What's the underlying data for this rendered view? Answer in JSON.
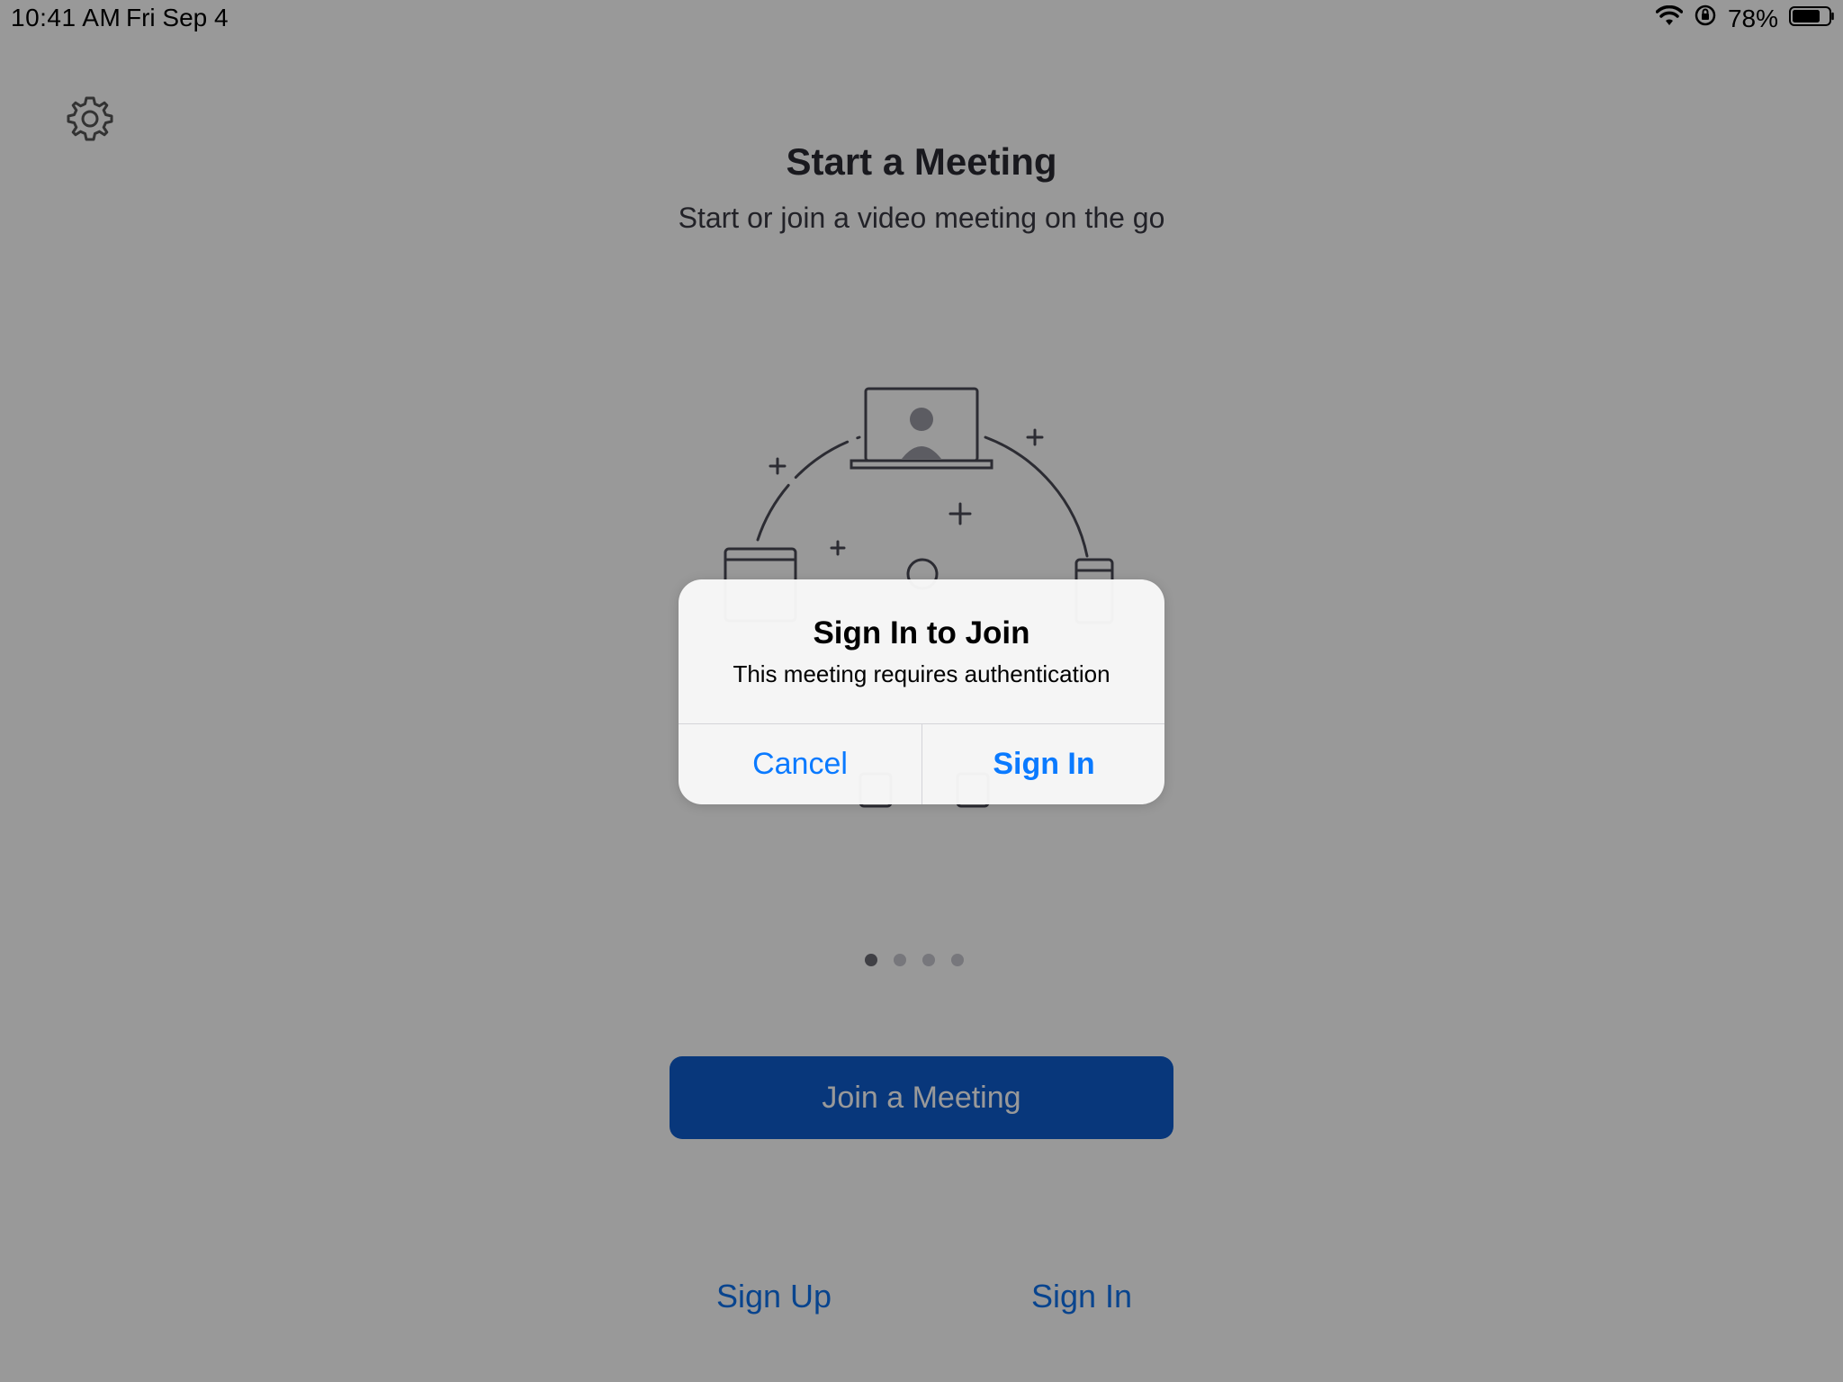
{
  "status_bar": {
    "time": "10:41 AM",
    "date": "Fri Sep 4",
    "battery_percent": "78%",
    "wifi_icon": "wifi-icon",
    "orientation_lock_icon": "orientation-lock-icon",
    "battery_icon": "battery-icon",
    "battery_level": 0.78
  },
  "header": {
    "title": "Start a Meeting",
    "subtitle": "Start or join a video meeting on the go"
  },
  "carousel": {
    "pages": 4,
    "active_page": 1
  },
  "main": {
    "join_button_label": "Join a Meeting"
  },
  "footer": {
    "sign_up_label": "Sign Up",
    "sign_in_label": "Sign In"
  },
  "alert": {
    "title": "Sign In to Join",
    "message": "This meeting requires authentication",
    "cancel_label": "Cancel",
    "confirm_label": "Sign In"
  },
  "colors": {
    "primary_blue": "#0e5ccd",
    "link_blue": "#0e72ed",
    "ios_blue": "#0a7aff",
    "overlay": "rgba(0,0,0,0.40)"
  }
}
